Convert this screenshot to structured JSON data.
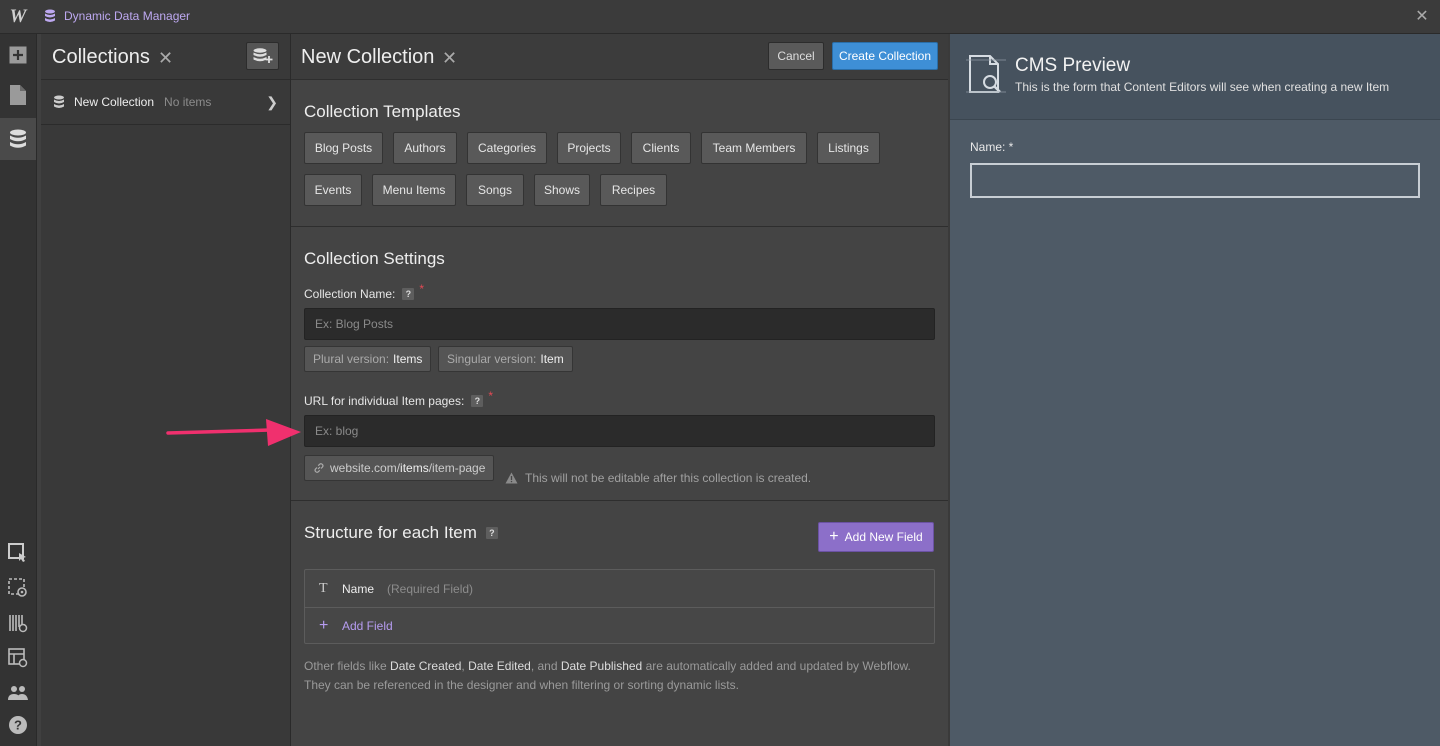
{
  "app": {
    "logo": "W",
    "title": "Dynamic Data Manager",
    "close_icon": "close-icon"
  },
  "rail": {
    "icons": [
      "add-icon",
      "pages-icon",
      "database-icon",
      "select-icon",
      "preview-icon",
      "grid-icon",
      "layout-preview-icon",
      "team-icon",
      "help-icon"
    ]
  },
  "collections": {
    "title": "Collections",
    "items": [
      {
        "name": "New Collection",
        "count": "No items"
      }
    ]
  },
  "main": {
    "title": "New Collection",
    "cancel_label": "Cancel",
    "create_label": "Create Collection",
    "templates": {
      "title": "Collection Templates",
      "row1": [
        "Blog Posts",
        "Authors",
        "Categories",
        "Projects",
        "Clients",
        "Team Members",
        "Listings"
      ],
      "row2": [
        "Events",
        "Menu Items",
        "Songs",
        "Shows",
        "Recipes"
      ]
    },
    "settings": {
      "title": "Collection Settings",
      "name_label": "Collection Name:",
      "name_placeholder": "Ex: Blog Posts",
      "plural_label": "Plural version:",
      "plural_value": "Items",
      "singular_label": "Singular version:",
      "singular_value": "Item",
      "url_label": "URL for individual Item pages:",
      "url_placeholder": "Ex: blog",
      "url_prefix": "website.com/",
      "url_bold": "items",
      "url_suffix": "/item-page",
      "url_warning": "This will not be editable after this collection is created.",
      "help": "?",
      "required": "*"
    },
    "structure": {
      "title": "Structure for each Item",
      "add_new_field_label": "Add New Field",
      "fields": [
        {
          "icon": "T",
          "name": "Name",
          "note": "(Required Field)"
        }
      ],
      "add_field_label": "Add Field",
      "note_pre": "Other fields like ",
      "note_date_created": "Date Created",
      "note_sep1": ", ",
      "note_date_edited": "Date Edited",
      "note_sep2": ", and ",
      "note_date_published": "Date Published",
      "note_post": " are automatically added and updated by Webflow.",
      "note_line2": "They can be referenced in the designer and when filtering or sorting dynamic lists."
    }
  },
  "preview": {
    "title": "CMS Preview",
    "subtitle": "This is the form that Content Editors will see when creating a new Item",
    "name_label": "Name: *"
  },
  "colors": {
    "accent_blue": "#3e8fd6",
    "accent_purple": "#8c6fc9",
    "arrow": "#f0306e",
    "required": "#e24a55"
  }
}
